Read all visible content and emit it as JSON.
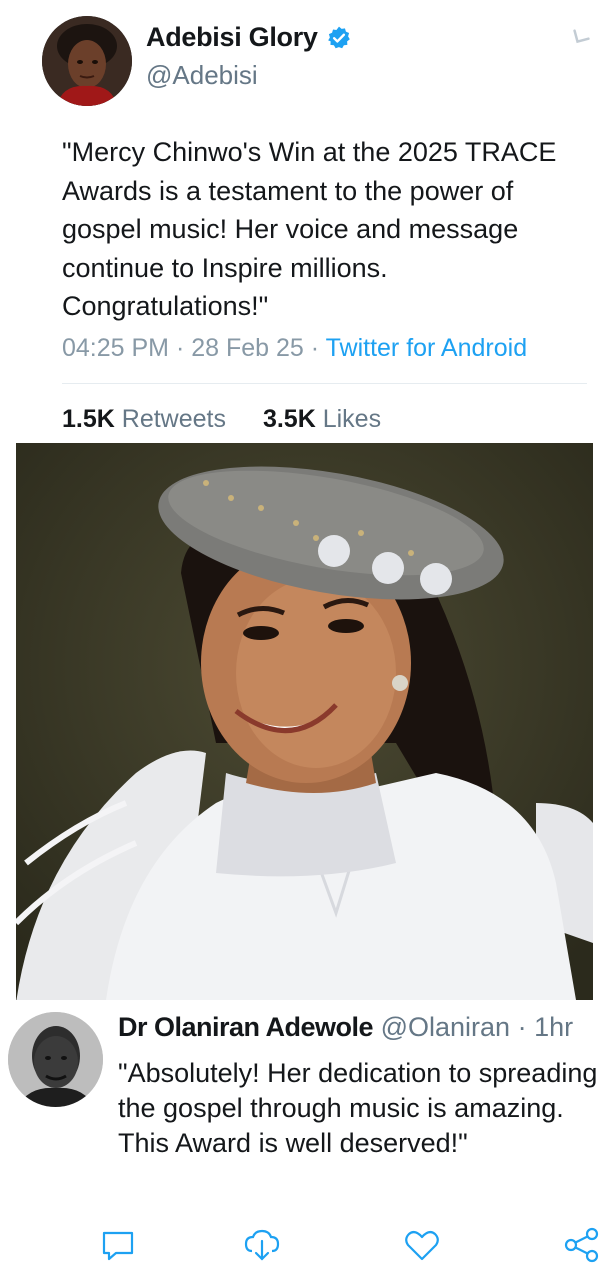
{
  "tweet": {
    "display_name": "Adebisi Glory",
    "handle": "@Adebisi",
    "text": "\"Mercy Chinwo's Win at the 2025 TRACE Awards is a testament to the power of gospel music! Her voice and message continue to Inspire millions. Congratulations!\"",
    "time": "04:25 PM",
    "date": "28 Feb 25",
    "source": "Twitter for Android",
    "retweets_count": "1.5K",
    "retweets_label": "Retweets",
    "likes_count": "3.5K",
    "likes_label": "Likes"
  },
  "reply": {
    "display_name": "Dr Olaniran Adewole",
    "handle": "@Olaniran",
    "time": "1hr",
    "text": "\"Absolutely! Her dedication to spreading the gospel through music is amazing. This Award is well deserved!\""
  },
  "actions": [
    "reply-icon",
    "retweet-icon",
    "like-icon",
    "share-icon"
  ],
  "colors": {
    "accent": "#1da1f2",
    "secondary_text": "#657786",
    "primary_text": "#14171a"
  }
}
